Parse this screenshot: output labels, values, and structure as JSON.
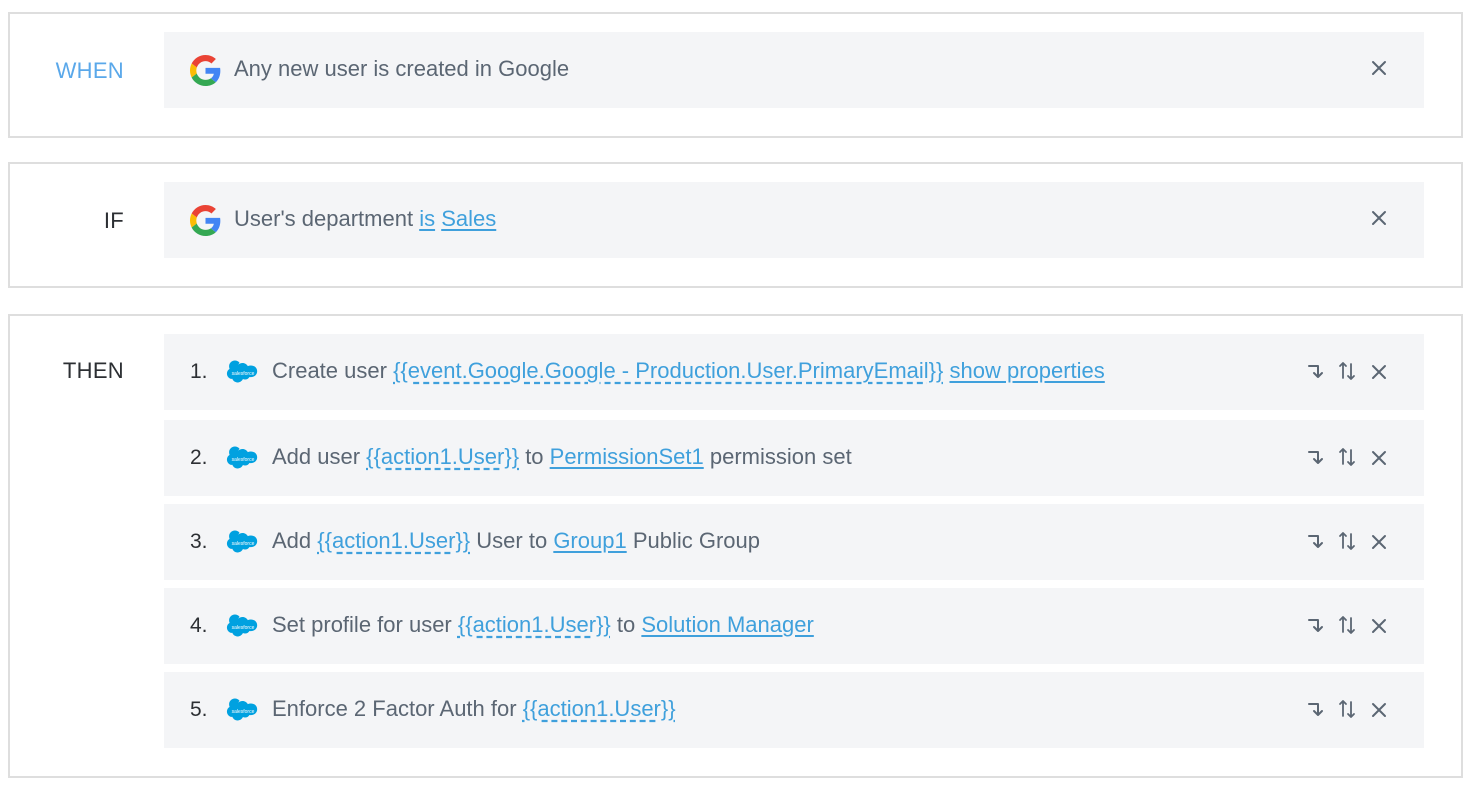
{
  "when": {
    "label": "WHEN",
    "trigger": {
      "icon": "google-icon",
      "text": "Any new user is created in Google"
    }
  },
  "if": {
    "label": "IF",
    "condition": {
      "icon": "google-icon",
      "prefix": "User's department",
      "operator": "is",
      "value": "Sales"
    }
  },
  "then": {
    "label": "THEN",
    "actions": [
      {
        "num": "1.",
        "icon": "salesforce-icon",
        "parts": [
          {
            "text": "Create user ",
            "style": "plain"
          },
          {
            "text": "{{event.Google.Google - Production.User.PrimaryEmail}}",
            "style": "dotted"
          },
          {
            "text": " ",
            "style": "plain"
          },
          {
            "text": "show properties",
            "style": "link"
          }
        ]
      },
      {
        "num": "2.",
        "icon": "salesforce-icon",
        "parts": [
          {
            "text": "Add user ",
            "style": "plain"
          },
          {
            "text": "{{action1.User}}",
            "style": "dotted"
          },
          {
            "text": " to ",
            "style": "plain"
          },
          {
            "text": "PermissionSet1",
            "style": "link"
          },
          {
            "text": " permission set",
            "style": "plain"
          }
        ]
      },
      {
        "num": "3.",
        "icon": "salesforce-icon",
        "parts": [
          {
            "text": "Add ",
            "style": "plain"
          },
          {
            "text": "{{action1.User}}",
            "style": "dotted"
          },
          {
            "text": " User to ",
            "style": "plain"
          },
          {
            "text": "Group1",
            "style": "link"
          },
          {
            "text": " Public Group",
            "style": "plain"
          }
        ]
      },
      {
        "num": "4.",
        "icon": "salesforce-icon",
        "parts": [
          {
            "text": "Set profile for user ",
            "style": "plain"
          },
          {
            "text": "{{action1.User}}",
            "style": "dotted"
          },
          {
            "text": " to ",
            "style": "plain"
          },
          {
            "text": "Solution Manager",
            "style": "link"
          }
        ]
      },
      {
        "num": "5.",
        "icon": "salesforce-icon",
        "parts": [
          {
            "text": "Enforce 2 Factor Auth for ",
            "style": "plain"
          },
          {
            "text": "{{action1.User}}",
            "style": "dotted"
          }
        ]
      }
    ]
  },
  "colors": {
    "accent": "#3fa0dc",
    "when_label": "#5aa8ea",
    "row_bg": "#f4f5f7",
    "border": "#dedede",
    "salesforce_blue": "#00a1e0"
  }
}
